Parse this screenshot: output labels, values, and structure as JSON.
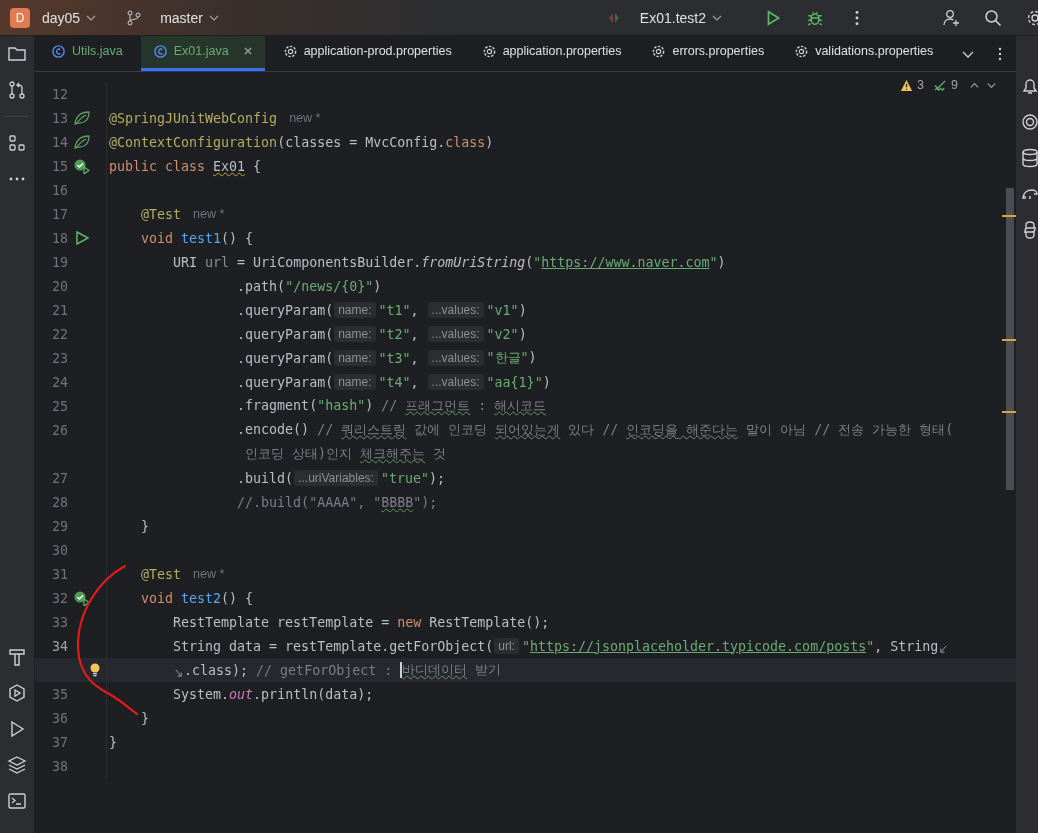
{
  "toolbar": {
    "project": {
      "badge": "D",
      "name": "day05"
    },
    "branch": "master",
    "run_config": "Ex01.test2"
  },
  "tabs": [
    {
      "label": "Utils.java",
      "kind": "class",
      "added": true,
      "selected": false
    },
    {
      "label": "Ex01.java",
      "kind": "class",
      "added": true,
      "selected": true
    },
    {
      "label": "application-prod.properties",
      "kind": "properties",
      "added": false,
      "selected": false
    },
    {
      "label": "application.properties",
      "kind": "properties",
      "added": false,
      "selected": false
    },
    {
      "label": "errors.properties",
      "kind": "properties",
      "added": false,
      "selected": false
    },
    {
      "label": "validations.properties",
      "kind": "properties",
      "added": false,
      "selected": false
    }
  ],
  "inspections": {
    "warnings": "3",
    "passed": "9"
  },
  "editor": {
    "lines": [
      {
        "n": "12"
      },
      {
        "n": "13",
        "gutter": {
          "kind": "leaf"
        },
        "c": [
          {
            "text": "@SpringJUnitWebConfig",
            "kind": "ann"
          },
          {
            "text": "new *",
            "kind": "author"
          }
        ]
      },
      {
        "n": "14",
        "gutter": {
          "kind": "leaf"
        },
        "c": [
          {
            "text": "@ContextConfiguration",
            "kind": "ann"
          },
          {
            "text": "(classes = MvcConfig.",
            "kind": "p"
          },
          {
            "text": "class",
            "kind": "kw"
          },
          {
            "text": ")",
            "kind": "p"
          }
        ]
      },
      {
        "n": "15",
        "gutter": {
          "kind": "test-ok"
        },
        "c": [
          {
            "text": "public class ",
            "kind": "kw"
          },
          {
            "text": "Ex01",
            "kind": "warn"
          },
          {
            "text": " {",
            "kind": "p"
          }
        ]
      },
      {
        "n": "16"
      },
      {
        "n": "17",
        "c": [
          {
            "text": "    @Test",
            "kind": "ann"
          },
          {
            "text": "new *",
            "kind": "author"
          }
        ]
      },
      {
        "n": "18",
        "gutter": {
          "kind": "run"
        },
        "c": [
          {
            "text": "    void ",
            "kind": "kw"
          },
          {
            "text": "test1",
            "kind": "fn"
          },
          {
            "text": "() {",
            "kind": "p"
          }
        ]
      },
      {
        "n": "19",
        "c": [
          {
            "text": "        URI ",
            "kind": "p"
          },
          {
            "text": "url",
            "kind": "unused"
          },
          {
            "text": " = UriComponentsBuilder.",
            "kind": "p"
          },
          {
            "text": "fromUriString",
            "kind": "st"
          },
          {
            "text": "(",
            "kind": "p"
          },
          {
            "text": "\"",
            "kind": "str"
          },
          {
            "text": "https://www.naver.com",
            "kind": "url"
          },
          {
            "text": "\"",
            "kind": "str"
          },
          {
            "text": ")",
            "kind": "p"
          }
        ]
      },
      {
        "n": "20",
        "c": [
          {
            "text": "                .path(",
            "kind": "p"
          },
          {
            "text": "\"/news/{0}\"",
            "kind": "str"
          },
          {
            "text": ")",
            "kind": "p"
          }
        ]
      },
      {
        "n": "21",
        "c": [
          {
            "text": "                .queryParam(",
            "kind": "p"
          },
          {
            "text": "name:",
            "kind": "hint"
          },
          {
            "text": "\"t1\"",
            "kind": "str"
          },
          {
            "text": ", ",
            "kind": "p"
          },
          {
            "text": "...values:",
            "kind": "hint"
          },
          {
            "text": "\"v1\"",
            "kind": "str"
          },
          {
            "text": ")",
            "kind": "p"
          }
        ]
      },
      {
        "n": "22",
        "c": [
          {
            "text": "                .queryParam(",
            "kind": "p"
          },
          {
            "text": "name:",
            "kind": "hint"
          },
          {
            "text": "\"t2\"",
            "kind": "str"
          },
          {
            "text": ", ",
            "kind": "p"
          },
          {
            "text": "...values:",
            "kind": "hint"
          },
          {
            "text": "\"v2\"",
            "kind": "str"
          },
          {
            "text": ")",
            "kind": "p"
          }
        ]
      },
      {
        "n": "23",
        "c": [
          {
            "text": "                .queryParam(",
            "kind": "p"
          },
          {
            "text": "name:",
            "kind": "hint"
          },
          {
            "text": "\"t3\"",
            "kind": "str"
          },
          {
            "text": ", ",
            "kind": "p"
          },
          {
            "text": "...values:",
            "kind": "hint"
          },
          {
            "text": "\"한글\"",
            "kind": "str"
          },
          {
            "text": ")",
            "kind": "p"
          }
        ]
      },
      {
        "n": "24",
        "c": [
          {
            "text": "                .queryParam(",
            "kind": "p"
          },
          {
            "text": "name:",
            "kind": "hint"
          },
          {
            "text": "\"t4\"",
            "kind": "str"
          },
          {
            "text": ", ",
            "kind": "p"
          },
          {
            "text": "...values:",
            "kind": "hint"
          },
          {
            "text": "\"aa{1}\"",
            "kind": "str"
          },
          {
            "text": ")",
            "kind": "p"
          }
        ]
      },
      {
        "n": "25",
        "c": [
          {
            "text": "                .fragment(",
            "kind": "p"
          },
          {
            "text": "\"hash\"",
            "kind": "str"
          },
          {
            "text": ")",
            "kind": "p"
          },
          {
            "text": " // ",
            "kind": "cm"
          },
          {
            "text": "프래그먼트",
            "kind": "cmtypo"
          },
          {
            "text": " : ",
            "kind": "cm"
          },
          {
            "text": "해시코드",
            "kind": "cmtypo"
          }
        ]
      },
      {
        "n": "26",
        "c": [
          {
            "text": "                .encode()",
            "kind": "p"
          },
          {
            "text": " // ",
            "kind": "cm"
          },
          {
            "text": "쿼리스트링",
            "kind": "cmtypo"
          },
          {
            "text": " 값에 인코딩 ",
            "kind": "cm"
          },
          {
            "text": "되어있는게",
            "kind": "cmtypo"
          },
          {
            "text": " 있다 // ",
            "kind": "cm"
          },
          {
            "text": "인코딩을",
            "kind": "cmtypo"
          },
          {
            "text": " 해준다는",
            "kind": "cmtypo"
          },
          {
            "text": " 말이 아님 // 전송 가능한 형태(",
            "kind": "cm"
          }
        ]
      },
      {
        "c": [
          {
            "text": "                 인코딩 상태)인지 ",
            "kind": "cm"
          },
          {
            "text": "체크해주는",
            "kind": "cmtypo"
          },
          {
            "text": " 것",
            "kind": "cm"
          }
        ]
      },
      {
        "n": "27",
        "c": [
          {
            "text": "                .build(",
            "kind": "p"
          },
          {
            "text": "...uriVariables:",
            "kind": "hint"
          },
          {
            "text": "\"true\"",
            "kind": "str"
          },
          {
            "text": ");",
            "kind": "p"
          }
        ]
      },
      {
        "n": "28",
        "c": [
          {
            "text": "                //.build(\"AAAA\", \"",
            "kind": "cm"
          },
          {
            "text": "BBBB",
            "kind": "cmtypo"
          },
          {
            "text": "\");",
            "kind": "cm"
          }
        ]
      },
      {
        "n": "29",
        "c": [
          {
            "text": "    }",
            "kind": "p"
          }
        ]
      },
      {
        "n": "30"
      },
      {
        "n": "31",
        "c": [
          {
            "text": "    @Test",
            "kind": "ann"
          },
          {
            "text": "new *",
            "kind": "author"
          }
        ]
      },
      {
        "n": "32",
        "gutter": {
          "kind": "test-ok"
        },
        "c": [
          {
            "text": "    void ",
            "kind": "kw"
          },
          {
            "text": "test2",
            "kind": "fn"
          },
          {
            "text": "() {",
            "kind": "p"
          }
        ]
      },
      {
        "n": "33",
        "c": [
          {
            "text": "        RestTemplate restTemplate = ",
            "kind": "p"
          },
          {
            "text": "new",
            "kind": "kw"
          },
          {
            "text": " RestTemplate();",
            "kind": "p"
          }
        ]
      },
      {
        "n": "34",
        "active_number": true,
        "c": [
          {
            "text": "        String data = restTemplate.getForObject(",
            "kind": "p"
          },
          {
            "text": "url:",
            "kind": "hint"
          },
          {
            "text": "\"",
            "kind": "str"
          },
          {
            "text": "https://jsonplaceholder.typicode.com/posts",
            "kind": "url"
          },
          {
            "text": "\"",
            "kind": "str"
          },
          {
            "text": ", String",
            "kind": "p"
          },
          {
            "kind": "wrap-out"
          }
        ]
      },
      {
        "gutter": {
          "kind": "bulb"
        },
        "highlighted": true,
        "indent": true,
        "c": [
          {
            "kind": "wrap-in"
          },
          {
            "text": ".class); ",
            "kind": "p"
          },
          {
            "text": "// getForObject : ",
            "kind": "cm"
          },
          {
            "kind": "caret"
          },
          {
            "text": "바디데이터",
            "kind": "cmtypo"
          },
          {
            "text": " 받기",
            "kind": "cm"
          }
        ]
      },
      {
        "n": "35",
        "c": [
          {
            "text": "        System.",
            "kind": "p"
          },
          {
            "text": "out",
            "kind": "fld"
          },
          {
            "text": ".println(data);",
            "kind": "p"
          }
        ]
      },
      {
        "n": "36",
        "c": [
          {
            "text": "    }",
            "kind": "p"
          }
        ]
      },
      {
        "n": "37",
        "c": [
          {
            "text": "}",
            "kind": "p"
          }
        ]
      },
      {
        "n": "38"
      }
    ]
  }
}
